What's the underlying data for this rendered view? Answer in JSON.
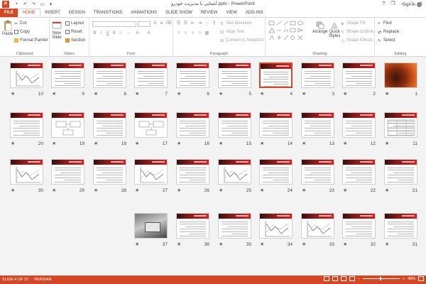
{
  "titlebar": {
    "app_icon": "P",
    "title": "آشنایی با مدیریت خودرو.pptx - PowerPoint",
    "help": "?",
    "restore": "❐",
    "minimize": "–",
    "maximize": "□",
    "close": "✕"
  },
  "tabs": [
    "FILE",
    "HOME",
    "INSERT",
    "DESIGN",
    "TRANSITIONS",
    "ANIMATIONS",
    "SLIDE SHOW",
    "REVIEW",
    "VIEW",
    "ADD-INS"
  ],
  "active_tab": "HOME",
  "signin": "Sign in",
  "ribbon": {
    "clipboard": {
      "label": "Clipboard",
      "paste": "Paste",
      "cut": "Cut",
      "copy": "Copy",
      "format_painter": "Format Painter"
    },
    "slides": {
      "label": "Slides",
      "new_slide": "New",
      "new_slide2": "Slide",
      "layout": "Layout",
      "reset": "Reset",
      "section": "Section"
    },
    "font": {
      "label": "Font"
    },
    "paragraph": {
      "label": "Paragraph",
      "text_direction": "Text Direction",
      "align_text": "Align Text",
      "convert": "Convert to SmartArt"
    },
    "drawing": {
      "label": "Drawing",
      "arrange": "Arrange",
      "quick_styles": "Quick",
      "quick_styles2": "Styles",
      "shape_fill": "Shape Fill",
      "shape_outline": "Shape Outline",
      "shape_effects": "Shape Effects"
    },
    "editing": {
      "label": "Editing",
      "find": "Find",
      "replace": "Replace",
      "select": "Select"
    }
  },
  "slides": [
    {
      "n": "1",
      "kind": "cover"
    },
    {
      "n": "2",
      "kind": "text"
    },
    {
      "n": "3",
      "kind": "text"
    },
    {
      "n": "4",
      "kind": "text",
      "selected": true
    },
    {
      "n": "5",
      "kind": "text"
    },
    {
      "n": "6",
      "kind": "text"
    },
    {
      "n": "7",
      "kind": "text"
    },
    {
      "n": "8",
      "kind": "text"
    },
    {
      "n": "9",
      "kind": "text"
    },
    {
      "n": "10",
      "kind": "chart"
    },
    {
      "n": "11",
      "kind": "table"
    },
    {
      "n": "12",
      "kind": "text"
    },
    {
      "n": "13",
      "kind": "text"
    },
    {
      "n": "14",
      "kind": "text"
    },
    {
      "n": "15",
      "kind": "text"
    },
    {
      "n": "16",
      "kind": "text"
    },
    {
      "n": "17",
      "kind": "diagram"
    },
    {
      "n": "18",
      "kind": "text"
    },
    {
      "n": "19",
      "kind": "diagram"
    },
    {
      "n": "20",
      "kind": "text"
    },
    {
      "n": "21",
      "kind": "text"
    },
    {
      "n": "22",
      "kind": "text"
    },
    {
      "n": "23",
      "kind": "text"
    },
    {
      "n": "24",
      "kind": "text"
    },
    {
      "n": "25",
      "kind": "chart"
    },
    {
      "n": "26",
      "kind": "text"
    },
    {
      "n": "27",
      "kind": "chart"
    },
    {
      "n": "28",
      "kind": "text"
    },
    {
      "n": "29",
      "kind": "text"
    },
    {
      "n": "30",
      "kind": "chart"
    },
    {
      "n": "31",
      "kind": "text"
    },
    {
      "n": "32",
      "kind": "text"
    },
    {
      "n": "33",
      "kind": "chart"
    },
    {
      "n": "34",
      "kind": "chart"
    },
    {
      "n": "35",
      "kind": "text"
    },
    {
      "n": "36",
      "kind": "text"
    },
    {
      "n": "37",
      "kind": "photo"
    }
  ],
  "slide_marker": "★",
  "statusbar": {
    "slide_info": "SLIDE 4 OF 37",
    "language": "PERSIAN",
    "zoom": "48%",
    "zoom_minus": "−",
    "zoom_plus": "+",
    "zoom_level": 0.48
  }
}
